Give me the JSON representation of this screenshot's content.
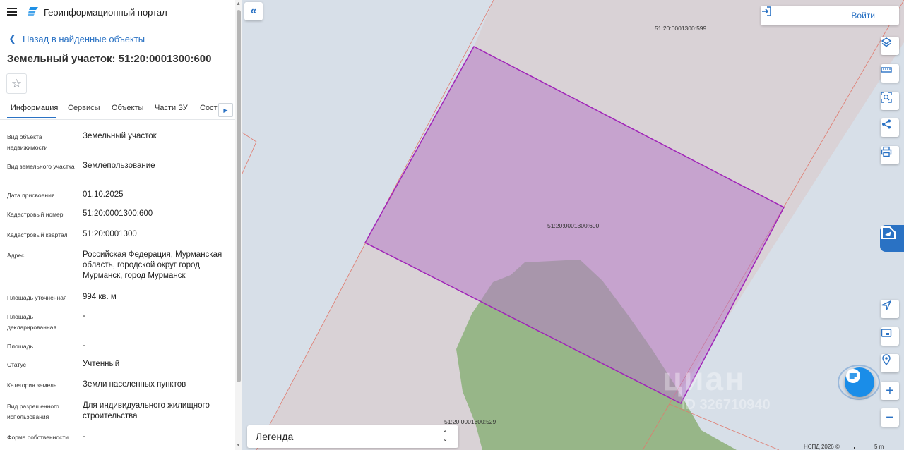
{
  "header": {
    "app_title": "Геоинформационный портал"
  },
  "panel": {
    "back_link": "Назад в найденные объекты",
    "title": "Земельный участок: 51:20:0001300:600",
    "tabs": [
      {
        "label": "Информация",
        "active": true
      },
      {
        "label": "Сервисы",
        "active": false
      },
      {
        "label": "Объекты",
        "active": false
      },
      {
        "label": "Части ЗУ",
        "active": false
      },
      {
        "label": "Соста",
        "active": false
      }
    ],
    "properties": [
      {
        "label": "Вид объекта недвижимости",
        "value": "Земельный участок"
      },
      {
        "label": "Вид земельного участка",
        "value": "Землепользование"
      },
      {
        "label": "Дата присвоения",
        "value": "01.10.2025"
      },
      {
        "label": "Кадастровый номер",
        "value": "51:20:0001300:600"
      },
      {
        "label": "Кадастровый квартал",
        "value": "51:20:0001300"
      },
      {
        "label": "Адрес",
        "value": "Российская Федерация, Мурманская область, городской округ город Мурманск, город Мурманск"
      },
      {
        "label": "Площадь уточненная",
        "value": "994 кв. м"
      },
      {
        "label": "Площадь декларированная",
        "value": "-"
      },
      {
        "label": "Площадь",
        "value": "-"
      },
      {
        "label": "Статус",
        "value": "Учтенный"
      },
      {
        "label": "Категория земель",
        "value": "Земли населенных пунктов"
      },
      {
        "label": "Вид разрешенного использования",
        "value": "Для индивидуального жилищного строительства"
      },
      {
        "label": "Форма собственности",
        "value": "-"
      }
    ]
  },
  "map": {
    "login_label": "Войти",
    "parcel_labels": {
      "north": "51:20:0001300:599",
      "selected": "51:20:0001300:600",
      "south": "51:20:0001300:529"
    },
    "legend_label": "Легенда",
    "attribution": "НСПД 2026 ©",
    "scale_label": "5 m",
    "watermark": "циан",
    "watermark_id": "ID 326710940",
    "colors": {
      "background": "#d7dfe8",
      "parcel_fill": "#d9d2d6",
      "selected_fill": "#c9abd2",
      "selected_stroke": "#a024b8",
      "neighbor_stroke": "#e07a6e",
      "green_area": "#97b688",
      "accent": "#2a72c4"
    },
    "tools": [
      "layers-icon",
      "ruler-icon",
      "select-area-icon",
      "share-icon",
      "print-icon",
      "locate-icon",
      "minimap-icon",
      "geolocation-icon",
      "zoom-in-icon",
      "zoom-out-icon"
    ]
  }
}
